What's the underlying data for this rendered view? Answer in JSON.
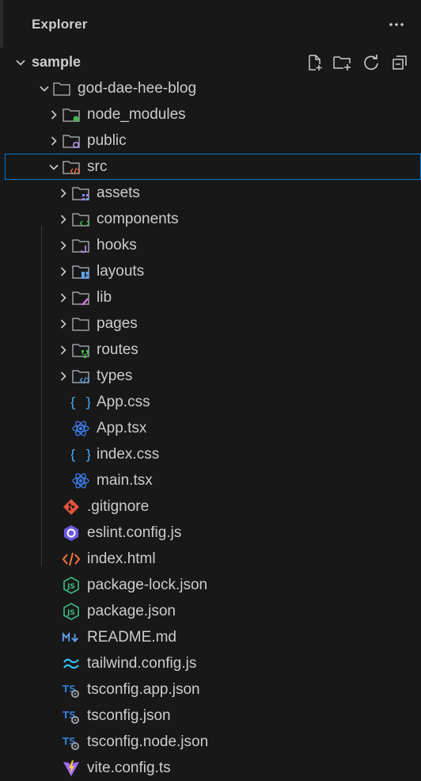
{
  "explorer": {
    "title": "Explorer",
    "more_actions_icon": "ellipsis-icon"
  },
  "root": {
    "label": "sample",
    "actions": [
      "new-file-icon",
      "new-folder-icon",
      "refresh-icon",
      "collapse-all-icon"
    ]
  },
  "items": [
    {
      "label": "god-dae-hee-blog",
      "kind": "folder",
      "expanded": true,
      "icon": "folder-icon"
    },
    {
      "label": "node_modules",
      "kind": "folder",
      "expanded": false,
      "icon": "folder-node-icon"
    },
    {
      "label": "public",
      "kind": "folder",
      "expanded": false,
      "icon": "folder-public-icon"
    },
    {
      "label": "src",
      "kind": "folder",
      "expanded": true,
      "icon": "folder-src-icon"
    },
    {
      "label": "assets",
      "kind": "folder",
      "expanded": false,
      "icon": "folder-assets-icon"
    },
    {
      "label": "components",
      "kind": "folder",
      "expanded": false,
      "icon": "folder-components-icon"
    },
    {
      "label": "hooks",
      "kind": "folder",
      "expanded": false,
      "icon": "folder-hooks-icon"
    },
    {
      "label": "layouts",
      "kind": "folder",
      "expanded": false,
      "icon": "folder-layouts-icon"
    },
    {
      "label": "lib",
      "kind": "folder",
      "expanded": false,
      "icon": "folder-lib-icon"
    },
    {
      "label": "pages",
      "kind": "folder",
      "expanded": false,
      "icon": "folder-icon"
    },
    {
      "label": "routes",
      "kind": "folder",
      "expanded": false,
      "icon": "folder-routes-icon"
    },
    {
      "label": "types",
      "kind": "folder",
      "expanded": false,
      "icon": "folder-types-icon"
    },
    {
      "label": "App.css",
      "kind": "file",
      "icon": "css-icon"
    },
    {
      "label": "App.tsx",
      "kind": "file",
      "icon": "react-icon"
    },
    {
      "label": "index.css",
      "kind": "file",
      "icon": "css-icon"
    },
    {
      "label": "main.tsx",
      "kind": "file",
      "icon": "react-icon"
    },
    {
      "label": ".gitignore",
      "kind": "file",
      "icon": "git-icon"
    },
    {
      "label": "eslint.config.js",
      "kind": "file",
      "icon": "eslint-icon"
    },
    {
      "label": "index.html",
      "kind": "file",
      "icon": "html-icon"
    },
    {
      "label": "package-lock.json",
      "kind": "file",
      "icon": "nodejs-icon"
    },
    {
      "label": "package.json",
      "kind": "file",
      "icon": "nodejs-icon"
    },
    {
      "label": "README.md",
      "kind": "file",
      "icon": "markdown-icon"
    },
    {
      "label": "tailwind.config.js",
      "kind": "file",
      "icon": "tailwind-icon"
    },
    {
      "label": "tsconfig.app.json",
      "kind": "file",
      "icon": "tsconfig-icon"
    },
    {
      "label": "tsconfig.json",
      "kind": "file",
      "icon": "tsconfig-icon"
    },
    {
      "label": "tsconfig.node.json",
      "kind": "file",
      "icon": "tsconfig-icon"
    },
    {
      "label": "vite.config.ts",
      "kind": "file",
      "icon": "vite-icon"
    }
  ],
  "selected": "src",
  "colors": {
    "background": "#181818",
    "text": "#cccccc",
    "selection_border": "#0078d4"
  }
}
